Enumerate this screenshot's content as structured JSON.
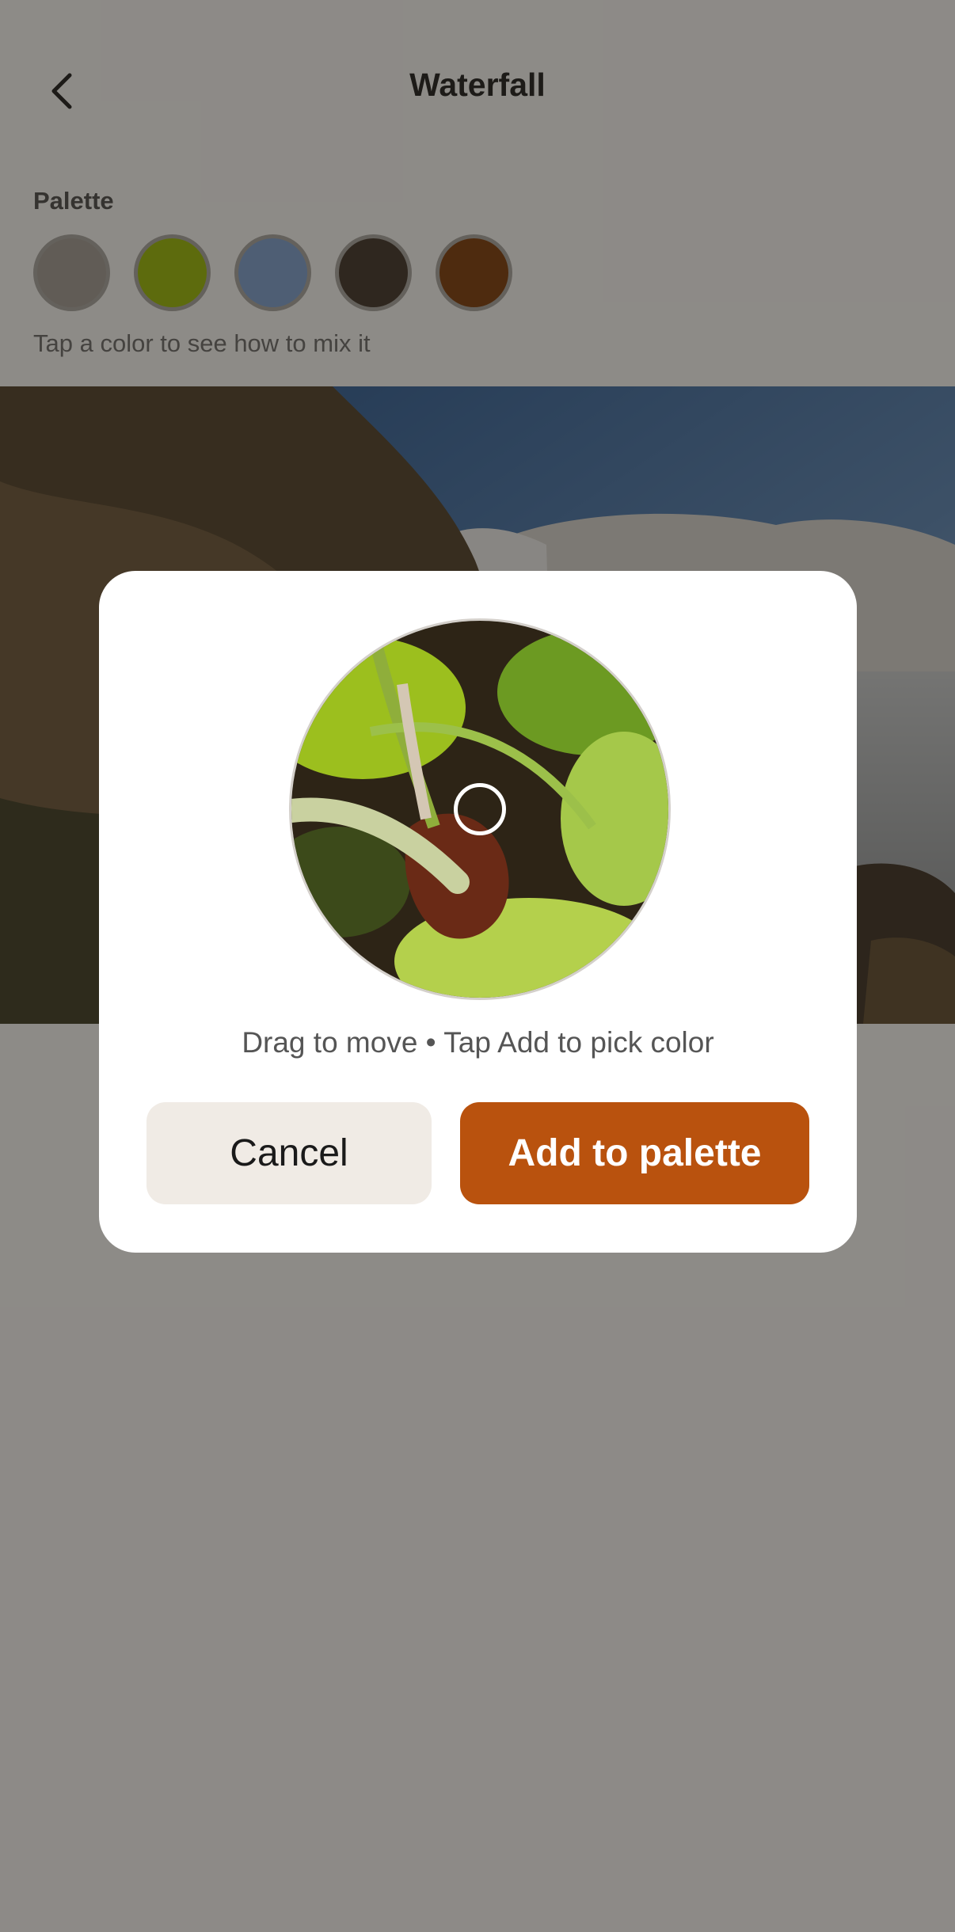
{
  "header": {
    "title": "Waterfall",
    "back_icon": "chevron-left-icon"
  },
  "palette": {
    "label": "Palette",
    "hint": "Tap a color to see how to mix it",
    "swatches": [
      {
        "name": "gray",
        "color": "#a39d96"
      },
      {
        "name": "olive",
        "color": "#9bbb05"
      },
      {
        "name": "slate-blue",
        "color": "#7ca0d2"
      },
      {
        "name": "dark-brown",
        "color": "#3e3328"
      },
      {
        "name": "rust-brown",
        "color": "#7d3a09"
      }
    ]
  },
  "dialog": {
    "instructions": "Drag to move • Tap Add to pick color",
    "cancel_label": "Cancel",
    "add_label": "Add to palette",
    "accent_color": "#b9520e"
  }
}
